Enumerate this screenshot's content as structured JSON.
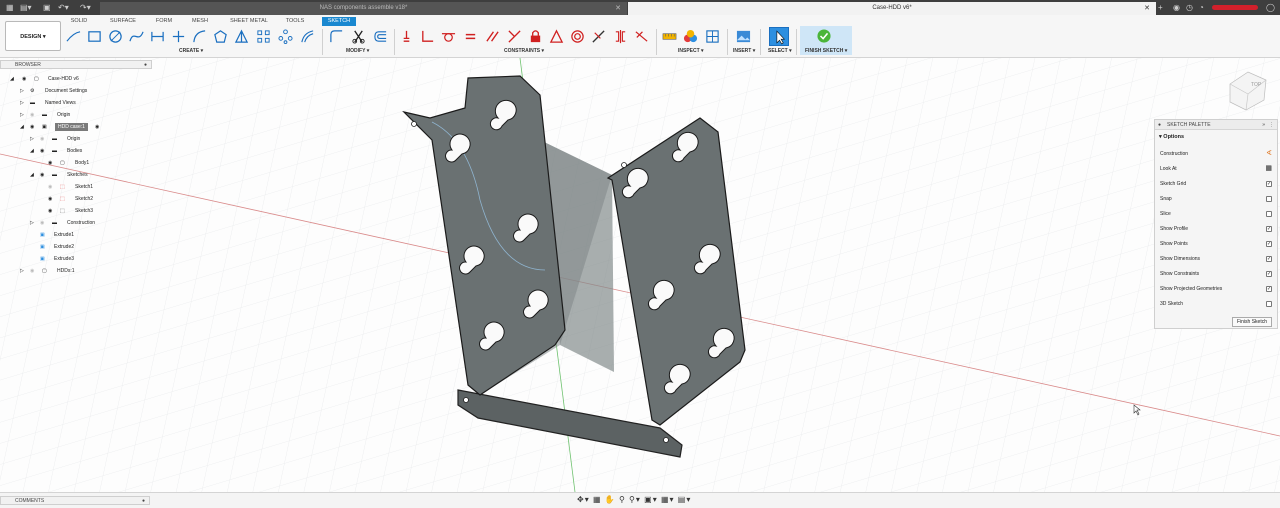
{
  "window": {
    "tab_inactive": "NAS components assemble v18*",
    "tab_active": "Case-HDD v6*"
  },
  "toolbar": {
    "design_label": "DESIGN ▾",
    "workspace_tabs": [
      "SOLID",
      "SURFACE",
      "FORM",
      "MESH",
      "SHEET METAL",
      "TOOLS",
      "SKETCH"
    ],
    "groups": {
      "create": "CREATE ▾",
      "modify": "MODIFY ▾",
      "constraints": "CONSTRAINTS ▾",
      "inspect": "INSPECT ▾",
      "insert": "INSERT ▾",
      "select": "SELECT ▾",
      "finish": "FINISH SKETCH ▾"
    }
  },
  "browser": {
    "header": "BROWSER",
    "items": [
      {
        "label": "Case-HDD v6"
      },
      {
        "label": "Document Settings"
      },
      {
        "label": "Named Views"
      },
      {
        "label": "Origin"
      },
      {
        "label": "HDD case:1"
      },
      {
        "label": "Origin"
      },
      {
        "label": "Bodies"
      },
      {
        "label": "Body1"
      },
      {
        "label": "Sketches"
      },
      {
        "label": "Sketch1"
      },
      {
        "label": "Sketch2"
      },
      {
        "label": "Sketch3"
      },
      {
        "label": "Construction"
      },
      {
        "label": "Extrude1"
      },
      {
        "label": "Extrude2"
      },
      {
        "label": "Extrude3"
      },
      {
        "label": "HDDs:1"
      }
    ]
  },
  "palette": {
    "header": "SKETCH PALETTE",
    "options_label": "Options",
    "options": [
      {
        "label": "Construction",
        "mark": "∢"
      },
      {
        "label": "Look At",
        "mark": "▦"
      },
      {
        "label": "Sketch Grid",
        "mark": "✓"
      },
      {
        "label": "Snap",
        "mark": ""
      },
      {
        "label": "Slice",
        "mark": ""
      },
      {
        "label": "Show Profile",
        "mark": "✓"
      },
      {
        "label": "Show Points",
        "mark": "✓"
      },
      {
        "label": "Show Dimensions",
        "mark": "✓"
      },
      {
        "label": "Show Constraints",
        "mark": "✓"
      },
      {
        "label": "Show Projected Geometries",
        "mark": "✓"
      },
      {
        "label": "3D Sketch",
        "mark": ""
      }
    ],
    "finish_button": "Finish Sketch"
  },
  "viewcube": {
    "label": "TOP"
  },
  "status": {
    "comments": "COMMENTS"
  },
  "colors": {
    "accent": "#1a88d0",
    "part": "#6a7172",
    "titlebar": "#3e3e3e"
  }
}
